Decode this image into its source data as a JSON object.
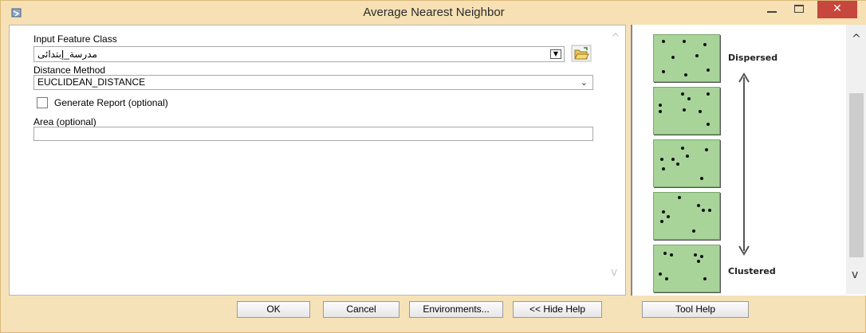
{
  "window": {
    "title": "Average Nearest Neighbor",
    "close_glyph": "✕"
  },
  "form": {
    "input_feature_class": {
      "label": "Input Feature Class",
      "value": "مدرسة_إبتدائى"
    },
    "distance_method": {
      "label": "Distance Method",
      "value": "EUCLIDEAN_DISTANCE"
    },
    "generate_report": {
      "label": "Generate Report (optional)",
      "checked": false
    },
    "area": {
      "label": "Area (optional)",
      "value": ""
    }
  },
  "help": {
    "dispersed_label": "Dispersed",
    "clustered_label": "Clustered",
    "square_color": "#a8d49a"
  },
  "buttons": {
    "ok": "OK",
    "cancel": "Cancel",
    "environments": "Environments...",
    "hide_help": "<< Hide Help",
    "tool_help": "Tool Help"
  },
  "icons": {
    "app": "toolbox-icon",
    "folder": "open-folder-icon",
    "scroll_up": "chevron-up-icon",
    "scroll_down": "chevron-down-icon"
  }
}
